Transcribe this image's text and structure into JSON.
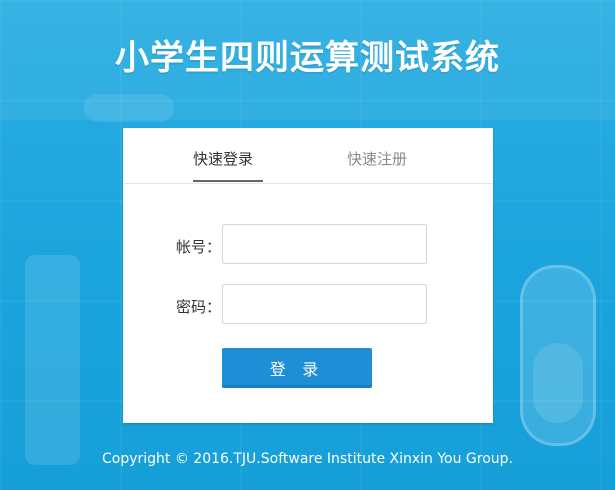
{
  "page": {
    "title": "小学生四则运算测试系统",
    "footer": "Copyright © 2016.TJU.Software Institute Xinxin You Group."
  },
  "tabs": {
    "login": "快速登录",
    "register": "快速注册"
  },
  "form": {
    "account_label": "帐号：",
    "password_label": "密码：",
    "account_value": "",
    "password_value": "",
    "login_button": "登 录"
  }
}
